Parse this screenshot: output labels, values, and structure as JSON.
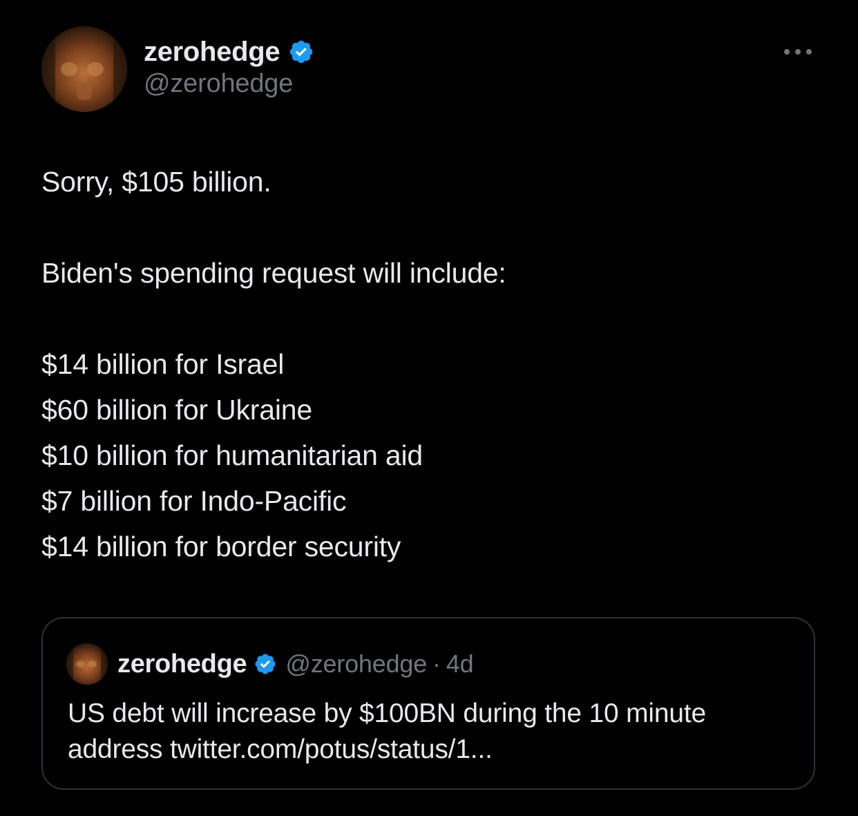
{
  "author": {
    "display_name": "zerohedge",
    "handle": "@zerohedge",
    "verified": true,
    "verified_color": "#1d9bf0"
  },
  "icons": {
    "verified": "verified-badge-icon",
    "more": "more-options-icon"
  },
  "tweet": {
    "lines": [
      "Sorry, $105 billion.",
      "Biden's spending request will include:",
      "$14 billion for Israel",
      "$60 billion for Ukraine",
      "$10 billion for humanitarian aid",
      "$7 billion for Indo-Pacific",
      "$14 billion for border security"
    ]
  },
  "quote": {
    "display_name": "zerohedge",
    "handle": "@zerohedge",
    "separator": "·",
    "time": "4d",
    "text_lines": [
      "US debt will increase by $100BN during the 10 minute",
      "address twitter.com/potus/status/1..."
    ]
  },
  "colors": {
    "background": "#000000",
    "text_primary": "#e7e9ea",
    "text_secondary": "#71767b",
    "border": "#2f3336",
    "accent": "#1d9bf0"
  }
}
